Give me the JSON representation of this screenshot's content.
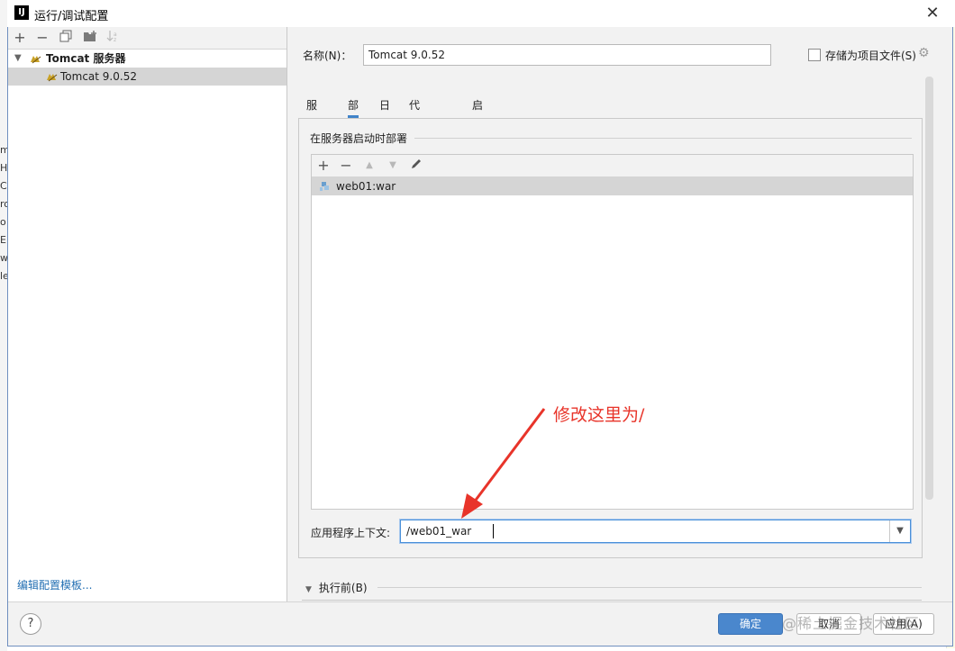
{
  "window": {
    "title": "运行/调试配置",
    "app_icon": "IJ"
  },
  "left_panel": {
    "toolbar": [
      "add-icon",
      "remove-icon",
      "copy-icon",
      "folder-add-icon",
      "sort-icon"
    ],
    "tree": {
      "group_label": "Tomcat 服务器",
      "item_label": "Tomcat 9.0.52"
    },
    "edit_templates_link": "编辑配置模板..."
  },
  "right_panel": {
    "name_label": "名称(N)：",
    "name_value": "Tomcat 9.0.52",
    "store_as_project_file": {
      "label": "存储为项目文件(S)",
      "checked": false
    },
    "tabs": [
      {
        "label": "服务器",
        "active": false
      },
      {
        "label": "部署",
        "active": true
      },
      {
        "label": "日志",
        "active": false
      },
      {
        "label": "代码覆盖率",
        "active": false
      },
      {
        "label": "启动/连接",
        "active": false
      }
    ],
    "deploy_section_title": "在服务器启动时部署",
    "deploy_list": {
      "items": [
        "web01:war"
      ]
    },
    "app_context_label": "应用程序上下文:",
    "app_context_value": "/web01_war",
    "before_launch_label": "执行前(B)"
  },
  "buttons": {
    "help": "?",
    "ok": "确定",
    "cancel": "取消",
    "apply": "应用(A)"
  },
  "annotation": {
    "text": "修改这里为/",
    "color": "#e8342a"
  },
  "watermark": "@稀土掘金技术社区",
  "colors": {
    "accent": "#4083c9",
    "ok_button": "#4a87cd",
    "selection": "#d5d5d5",
    "link": "#2470b3"
  }
}
